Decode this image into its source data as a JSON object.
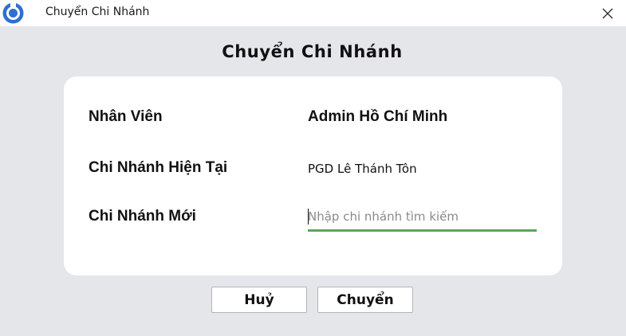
{
  "window": {
    "title": "Chuyển Chi Nhánh",
    "app_icon": "app-logo-icon",
    "close_icon": "close-icon"
  },
  "dialog": {
    "heading": "Chuyển Chi Nhánh"
  },
  "form": {
    "employee_label": "Nhân Viên",
    "employee_value": "Admin Hồ Chí Minh",
    "current_branch_label": "Chi Nhánh Hiện Tại",
    "current_branch_value": "PGD Lê Thánh Tôn",
    "new_branch_label": "Chi Nhánh Mới",
    "new_branch_value": "",
    "new_branch_placeholder": "Nhập chi nhánh tìm kiếm"
  },
  "buttons": {
    "cancel_label": "Huỷ",
    "transfer_label": "Chuyển"
  },
  "colors": {
    "accent_underline": "#5aa55a",
    "background": "#e4e6ea",
    "logo_blue": "#2f6fd0"
  }
}
